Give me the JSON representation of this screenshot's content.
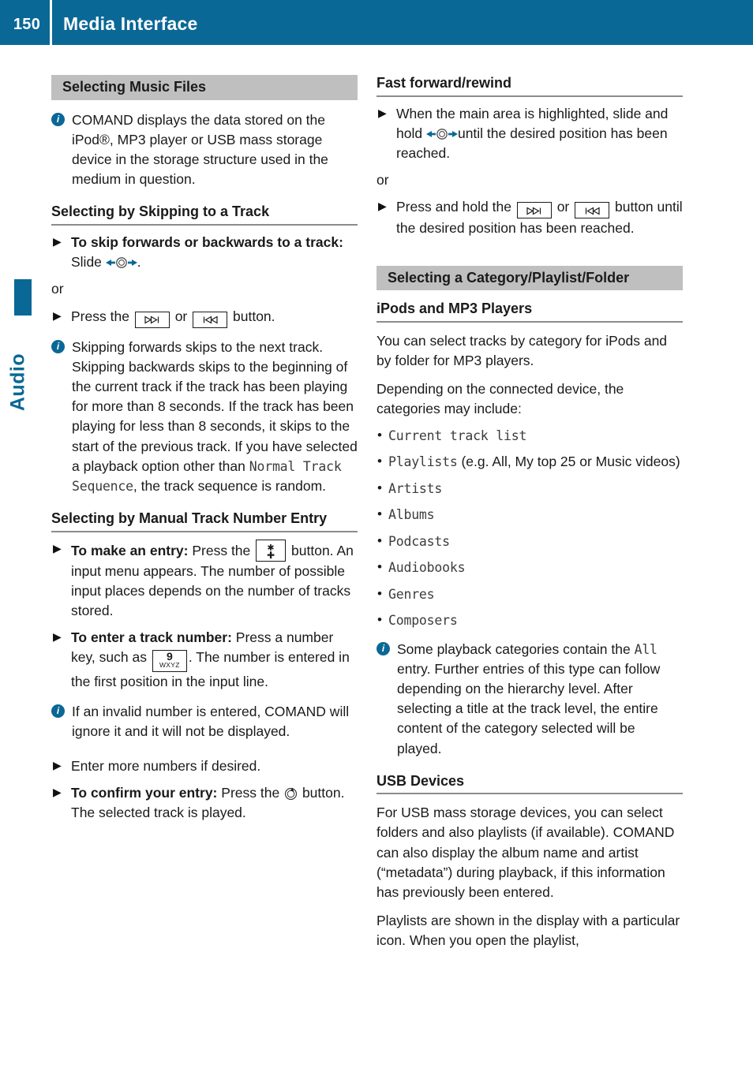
{
  "header": {
    "page_number": "150",
    "title": "Media Interface",
    "accent_color": "#0a6896"
  },
  "side_tab": {
    "label": "Audio"
  },
  "left_column": {
    "section_bar": "Selecting Music Files",
    "note_1": "COMAND displays the data stored on the iPod®, MP3 player or USB mass storage device in the storage structure used in the medium in question.",
    "heading_skip": "Selecting by Skipping to a Track",
    "step_skip_bold": "To skip forwards or backwards to a track:",
    "step_skip_rest": "Slide",
    "or_1": "or",
    "step_press_pre": "Press the",
    "step_press_mid": "or",
    "step_press_post": "button.",
    "note_2_a": "Skipping forwards skips to the next track. Skipping backwards skips to the beginning of the current track if the track has been playing for more than 8 seconds. If the track has been playing for less than 8 seconds, it skips to the start of the previous track. If you have selected a playback option other than ",
    "note_2_ui": "Normal Track Sequence",
    "note_2_b": ", the track sequence is random.",
    "heading_manual": "Selecting by Manual Track Number Entry",
    "step_entry_bold": "To make an entry:",
    "step_entry_pre": "Press the",
    "step_entry_post": "button. An input menu appears. The number of possible input places depends on the number of tracks stored.",
    "step_number_bold": "To enter a track number:",
    "step_number_pre": "Press a number key, such as",
    "step_number_post": ". The number is entered in the first position in the input line.",
    "note_3": "If an invalid number is entered, COMAND will ignore it and it will not be displayed.",
    "step_more": "Enter more numbers if desired.",
    "step_confirm_bold": "To confirm your entry:",
    "step_confirm_pre": "Press the",
    "step_confirm_post": "button. The selected track is played."
  },
  "right_column": {
    "heading_ff": "Fast forward/rewind",
    "step_ff_a": "When the main area is highlighted, slide and hold",
    "step_ff_b": "until the desired position has been reached.",
    "or_1": "or",
    "step_ff2_pre": "Press and hold the",
    "step_ff2_mid": "or",
    "step_ff2_post": "button until the desired position has been reached.",
    "section_bar": "Selecting a Category/Playlist/Folder",
    "heading_ipods": "iPods and MP3 Players",
    "para_1": "You can select tracks by category for iPods and by folder for MP3 players.",
    "para_2": "Depending on the connected device, the categories may include:",
    "categories": [
      {
        "ui": "Current track list",
        "suffix": ""
      },
      {
        "ui": "Playlists",
        "suffix": " (e.g. All, My top 25 or Music videos)"
      },
      {
        "ui": "Artists",
        "suffix": ""
      },
      {
        "ui": "Albums",
        "suffix": ""
      },
      {
        "ui": "Podcasts",
        "suffix": ""
      },
      {
        "ui": "Audiobooks",
        "suffix": ""
      },
      {
        "ui": "Genres",
        "suffix": ""
      },
      {
        "ui": "Composers",
        "suffix": ""
      }
    ],
    "note_1_a": "Some playback categories contain the ",
    "note_1_ui": "All",
    "note_1_b": " entry. Further entries of this type can follow depending on the hierarchy level. After selecting a title at the track level, the entire content of the category selected will be played.",
    "heading_usb": "USB Devices",
    "para_usb_1": "For USB mass storage devices, you can select folders and also playlists (if available). COMAND can also display the album name and artist (“metadata”) during playback, if this information has previously been entered.",
    "para_usb_2": "Playlists are shown in the display with a particular icon. When you open the playlist,"
  },
  "icons": {
    "info": "i",
    "bullet_triangle": "▶",
    "skip_forward_button": "skip-forward-button",
    "skip_back_button": "skip-back-button",
    "slide_control": "slide-left-right-controller",
    "star_key": "star-key-button",
    "number_key_digit": "9",
    "number_key_letters": "WXYZ",
    "press_controller": "press-controller"
  }
}
